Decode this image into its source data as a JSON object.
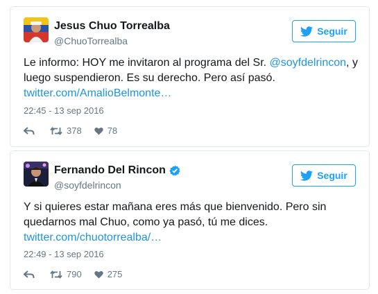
{
  "colors": {
    "accent": "#1da1f2",
    "link": "#1b95e0",
    "secondary_text": "#657786",
    "border": "#e1e8ed",
    "verified": "#1da1f2"
  },
  "tweets": [
    {
      "author": {
        "name": "Jesus Chuo Torrealba",
        "handle": "@ChuoTorrealba",
        "verified": false,
        "avatar": "avatar-photo"
      },
      "follow_label": "Seguir",
      "text": {
        "before_mention": "Le informo: HOY me invitaron al programa del Sr. ",
        "mention": "@soyfdelrincon",
        "after_mention": ", y luego suspendieron. Es su derecho. Pero así pasó.",
        "link": "twitter.com/AmalioBelmonte…"
      },
      "timestamp": "22:45 - 13 sep 2016",
      "retweets": "378",
      "likes": "78"
    },
    {
      "author": {
        "name": "Fernando Del Rincon",
        "handle": "@soyfdelrincon",
        "verified": true,
        "avatar": "avatar-photo"
      },
      "follow_label": "Seguir",
      "text": {
        "body": "Y si quieres estar mañana eres más que bienvenido. Pero sin quedarnos mal Chuo, como ya pasó, tú me dices.",
        "link": "twitter.com/chuotorrealba/…"
      },
      "timestamp": "22:49 - 13 sep 2016",
      "retweets": "790",
      "likes": "275"
    }
  ]
}
